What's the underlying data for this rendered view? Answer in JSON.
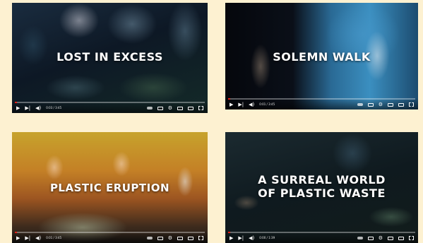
{
  "videos": [
    {
      "title": "LOST IN EXCESS",
      "time": "0:03 / 3:45",
      "progress": 0.01
    },
    {
      "title": "SOLEMN WALK",
      "time": "0:01 / 3:45",
      "progress": 0.01
    },
    {
      "title": "PLASTIC ERUPTION",
      "time": "0:01 / 3:45",
      "progress": 0.01
    },
    {
      "title": "A SURREAL WORLD\nOF PLASTIC WASTE",
      "time": "0:00 / 1:39",
      "progress": 0.0
    }
  ],
  "icons": {
    "play": "play-icon",
    "next": "next-icon",
    "volume": "volume-icon",
    "autoplay": "autoplay-toggle-icon",
    "captions": "captions-icon",
    "settings": "gear-icon",
    "miniplayer": "miniplayer-icon",
    "theater": "theater-icon",
    "fullscreen": "fullscreen-icon"
  },
  "colors": {
    "page_background": "#fdf1d1",
    "progress_red": "#e62117",
    "title_text": "#ffffff"
  }
}
